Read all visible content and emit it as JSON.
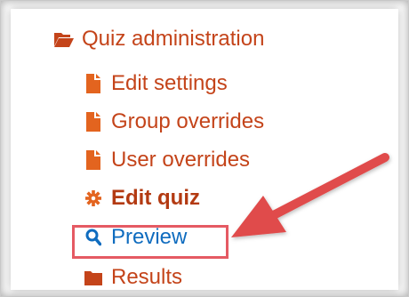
{
  "menu": {
    "parent_label": "Quiz administration",
    "items": [
      {
        "label": "Edit settings",
        "icon": "file-icon"
      },
      {
        "label": "Group overrides",
        "icon": "file-icon"
      },
      {
        "label": "User overrides",
        "icon": "file-icon"
      },
      {
        "label": "Edit quiz",
        "icon": "gear-icon"
      },
      {
        "label": "Preview",
        "icon": "search-icon"
      },
      {
        "label": "Results",
        "icon": "folder-icon"
      }
    ]
  },
  "colors": {
    "link": "#c4441a",
    "preview_link": "#0f6cbf",
    "highlight": "#e55a63",
    "arrow": "#e04c4c"
  }
}
